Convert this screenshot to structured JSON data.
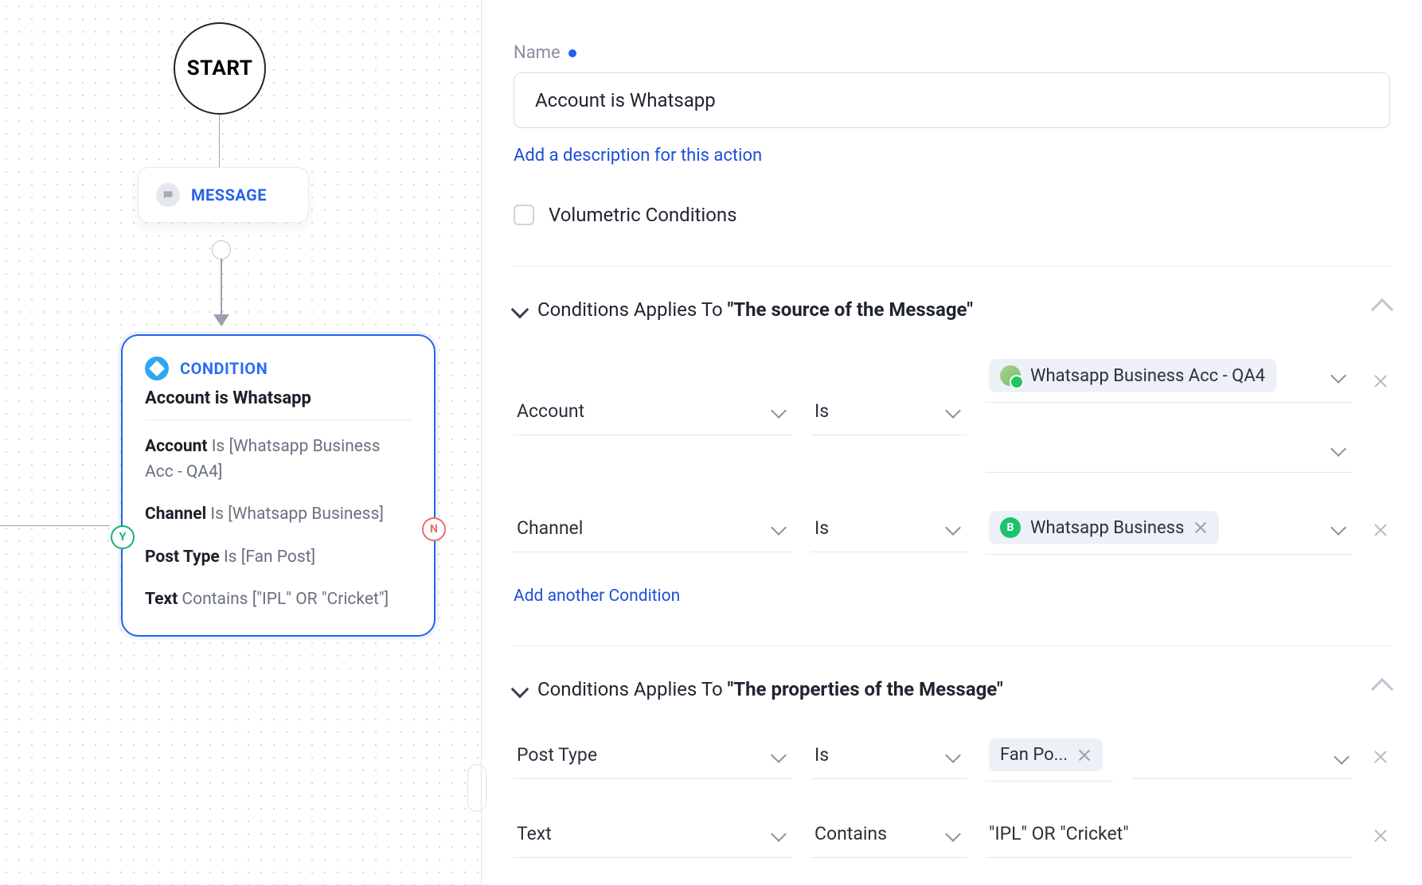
{
  "flow": {
    "start_label": "START",
    "message_node_label": "MESSAGE",
    "condition": {
      "type_label": "CONDITION",
      "title": "Account is Whatsapp",
      "lines": [
        {
          "field": "Account",
          "op": "Is",
          "value": "[Whatsapp Business Acc - QA4]"
        },
        {
          "field": "Channel",
          "op": "Is",
          "value": "[Whatsapp Business]"
        },
        {
          "field": "Post Type",
          "op": "Is",
          "value": "[Fan Post]"
        },
        {
          "field": "Text",
          "op": "Contains",
          "value": "[\"IPL\" OR \"Cricket\"]"
        }
      ],
      "yes_badge": "Y",
      "no_badge": "N"
    }
  },
  "panel": {
    "name_label": "Name",
    "name_value": "Account is Whatsapp",
    "add_description_link": "Add a description for this action",
    "volumetric_label": "Volumetric Conditions",
    "sections": [
      {
        "prefix": "Conditions Applies To ",
        "bold": "\"The source of the Message\"",
        "rows": [
          {
            "field": "Account",
            "op": "Is",
            "value_chips": [
              {
                "icon": "avatar",
                "text": "Whatsapp Business Acc - QA4",
                "removable": false
              }
            ],
            "has_second_empty_val": true
          },
          {
            "field": "Channel",
            "op": "Is",
            "value_chips": [
              {
                "icon": "whatsapp",
                "text": "Whatsapp Business",
                "removable": true
              }
            ],
            "has_second_empty_val": false
          }
        ],
        "add_link": "Add another Condition"
      },
      {
        "prefix": "Conditions Applies To ",
        "bold": "\"The properties of the Message\"",
        "rows": [
          {
            "field": "Post Type",
            "op": "Is",
            "value_chips": [
              {
                "icon": "",
                "text": "Fan Po...",
                "removable": true
              }
            ],
            "narrow_val": true
          },
          {
            "field": "Text",
            "op": "Contains",
            "plain_value": "\"IPL\" OR \"Cricket\""
          }
        ]
      }
    ]
  }
}
